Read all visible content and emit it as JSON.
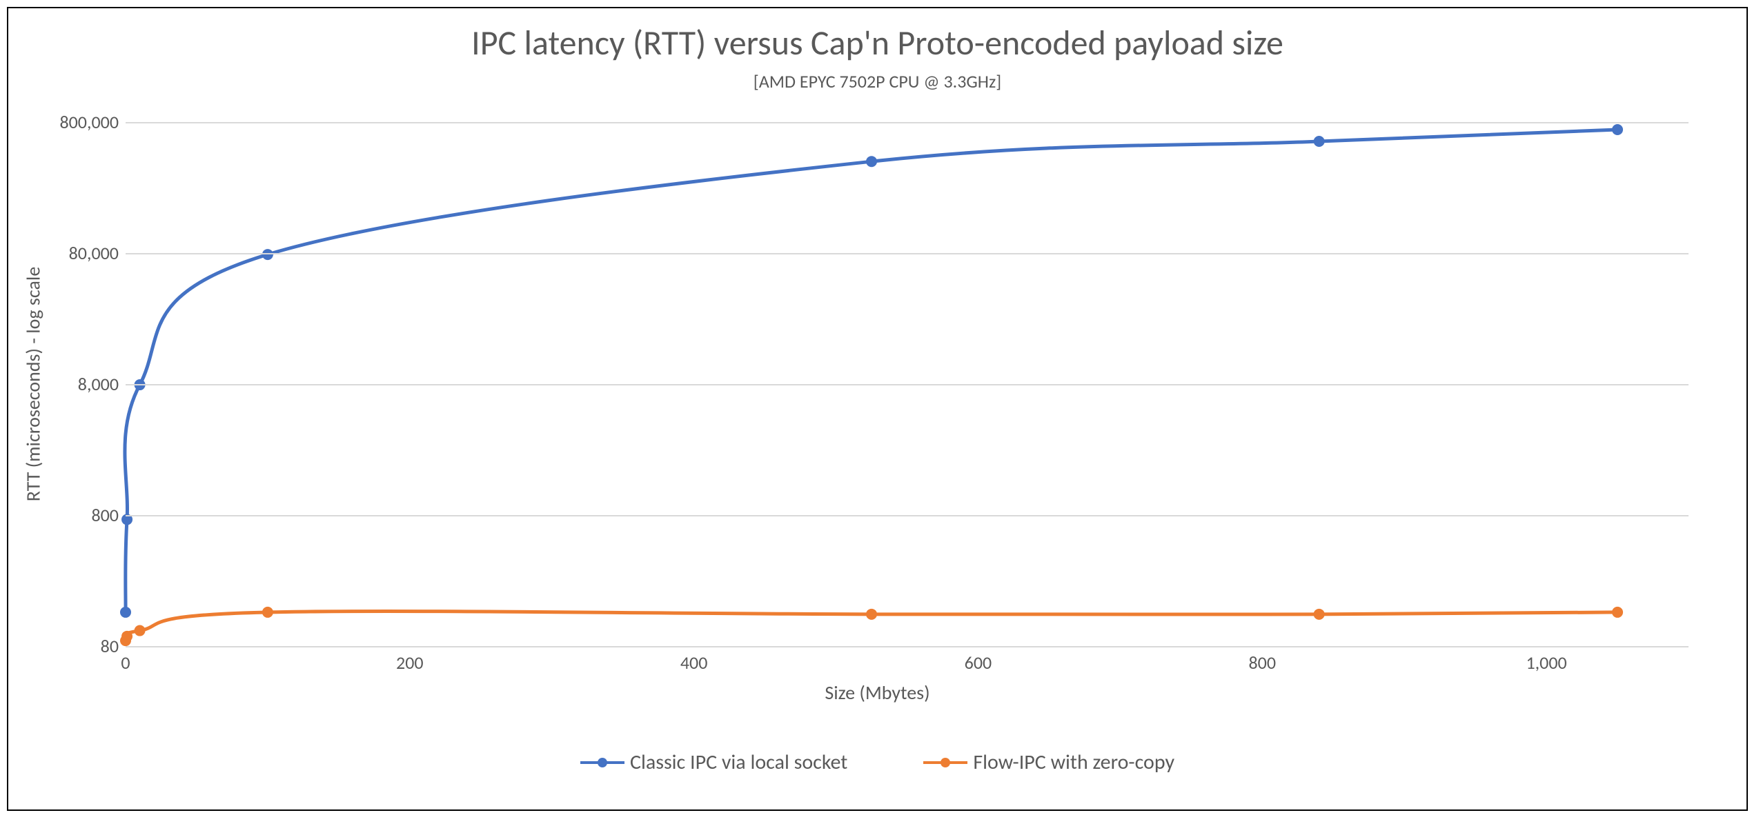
{
  "chart_data": {
    "type": "line",
    "title": "IPC latency (RTT) versus Cap'n Proto-encoded payload size",
    "subtitle": "[AMD EPYC 7502P CPU @ 3.3GHz]",
    "xlabel": "Size (Mbytes)",
    "ylabel": "RTT (microseconds) - log scale",
    "x": [
      0,
      1,
      10,
      100,
      525,
      840,
      1050
    ],
    "series": [
      {
        "name": "Classic IPC via local socket",
        "color": "#4472c4",
        "values": [
          145,
          740,
          7900,
          78000,
          400000,
          570000,
          700000
        ]
      },
      {
        "name": "Flow-IPC with zero-copy",
        "color": "#ed7d31",
        "values": [
          88,
          95,
          105,
          145,
          140,
          140,
          145
        ]
      }
    ],
    "x_ticks": [
      0,
      200,
      400,
      600,
      800,
      1000
    ],
    "x_tick_labels": [
      "0",
      "200",
      "400",
      "600",
      "800",
      "1,000"
    ],
    "y_ticks_log": [
      80,
      800,
      8000,
      80000,
      800000
    ],
    "y_tick_labels": [
      "80",
      "800",
      "8,000",
      "80,000",
      "800,000"
    ],
    "xlim": [
      0,
      1100
    ],
    "ylim_log": [
      80,
      800000
    ],
    "grid": {
      "horizontal": true
    },
    "legend_position": "bottom"
  }
}
